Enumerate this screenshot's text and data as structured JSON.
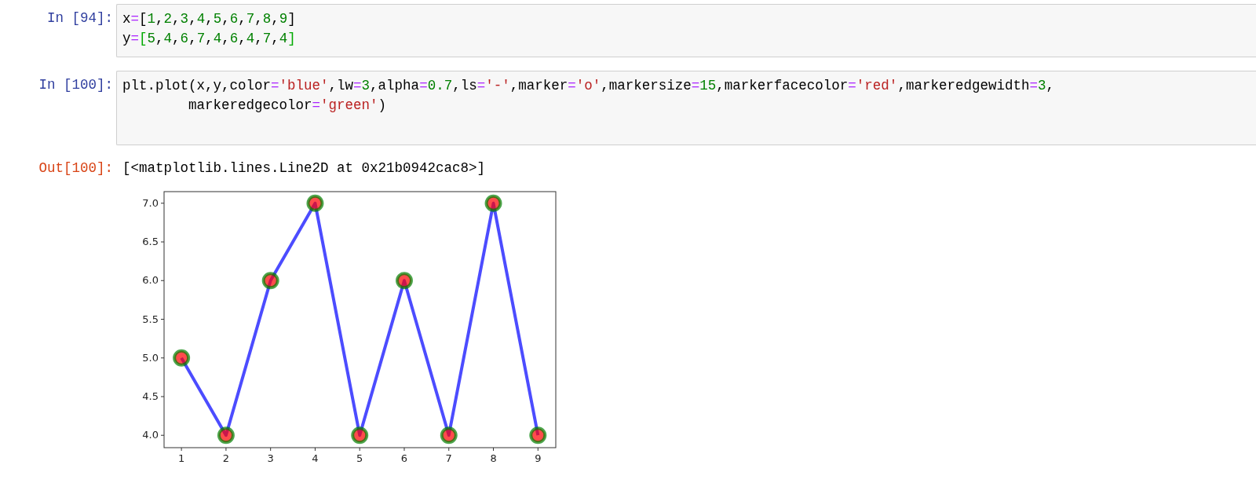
{
  "cells": [
    {
      "kind": "input",
      "prompt": "In [94]:",
      "lines": [
        [
          {
            "kind": "plain",
            "text": "x"
          },
          {
            "kind": "op",
            "text": "="
          },
          {
            "kind": "plain",
            "text": "["
          },
          {
            "kind": "num",
            "text": "1"
          },
          {
            "kind": "plain",
            "text": ","
          },
          {
            "kind": "num",
            "text": "2"
          },
          {
            "kind": "plain",
            "text": ","
          },
          {
            "kind": "num",
            "text": "3"
          },
          {
            "kind": "plain",
            "text": ","
          },
          {
            "kind": "num",
            "text": "4"
          },
          {
            "kind": "plain",
            "text": ","
          },
          {
            "kind": "num",
            "text": "5"
          },
          {
            "kind": "plain",
            "text": ","
          },
          {
            "kind": "num",
            "text": "6"
          },
          {
            "kind": "plain",
            "text": ","
          },
          {
            "kind": "num",
            "text": "7"
          },
          {
            "kind": "plain",
            "text": ","
          },
          {
            "kind": "num",
            "text": "8"
          },
          {
            "kind": "plain",
            "text": ","
          },
          {
            "kind": "num",
            "text": "9"
          },
          {
            "kind": "plain",
            "text": "]"
          }
        ],
        [
          {
            "kind": "plain",
            "text": "y"
          },
          {
            "kind": "op",
            "text": "="
          },
          {
            "kind": "match",
            "text": "["
          },
          {
            "kind": "num",
            "text": "5"
          },
          {
            "kind": "plain",
            "text": ","
          },
          {
            "kind": "num",
            "text": "4"
          },
          {
            "kind": "plain",
            "text": ","
          },
          {
            "kind": "num",
            "text": "6"
          },
          {
            "kind": "plain",
            "text": ","
          },
          {
            "kind": "num",
            "text": "7"
          },
          {
            "kind": "plain",
            "text": ","
          },
          {
            "kind": "num",
            "text": "4"
          },
          {
            "kind": "plain",
            "text": ","
          },
          {
            "kind": "num",
            "text": "6"
          },
          {
            "kind": "plain",
            "text": ","
          },
          {
            "kind": "num",
            "text": "4"
          },
          {
            "kind": "plain",
            "text": ","
          },
          {
            "kind": "num",
            "text": "7"
          },
          {
            "kind": "plain",
            "text": ","
          },
          {
            "kind": "num",
            "text": "4"
          },
          {
            "kind": "match",
            "text": "]"
          }
        ]
      ]
    },
    {
      "kind": "input",
      "prompt": "In [100]:",
      "lines": [
        [
          {
            "kind": "plain",
            "text": "plt.plot(x,y,color"
          },
          {
            "kind": "op",
            "text": "="
          },
          {
            "kind": "str",
            "text": "'blue'"
          },
          {
            "kind": "plain",
            "text": ",lw"
          },
          {
            "kind": "op",
            "text": "="
          },
          {
            "kind": "num",
            "text": "3"
          },
          {
            "kind": "plain",
            "text": ",alpha"
          },
          {
            "kind": "op",
            "text": "="
          },
          {
            "kind": "num",
            "text": "0.7"
          },
          {
            "kind": "plain",
            "text": ",ls"
          },
          {
            "kind": "op",
            "text": "="
          },
          {
            "kind": "str",
            "text": "'-'"
          },
          {
            "kind": "plain",
            "text": ",marker"
          },
          {
            "kind": "op",
            "text": "="
          },
          {
            "kind": "str",
            "text": "'o'"
          },
          {
            "kind": "plain",
            "text": ",markersize"
          },
          {
            "kind": "op",
            "text": "="
          },
          {
            "kind": "num",
            "text": "15"
          },
          {
            "kind": "plain",
            "text": ",markerfacecolor"
          },
          {
            "kind": "op",
            "text": "="
          },
          {
            "kind": "str",
            "text": "'red'"
          },
          {
            "kind": "plain",
            "text": ",markeredgewidth"
          },
          {
            "kind": "op",
            "text": "="
          },
          {
            "kind": "num",
            "text": "3"
          },
          {
            "kind": "plain",
            "text": ","
          }
        ],
        [
          {
            "kind": "plain",
            "text": "        markeredgecolor"
          },
          {
            "kind": "op",
            "text": "="
          },
          {
            "kind": "str",
            "text": "'green'"
          },
          {
            "kind": "plain",
            "text": ")"
          }
        ]
      ]
    },
    {
      "kind": "output",
      "prompt": "Out[100]:",
      "text": "[<matplotlib.lines.Line2D at 0x21b0942cac8>]"
    },
    {
      "kind": "figure",
      "chart_data": {
        "type": "line",
        "x": [
          1,
          2,
          3,
          4,
          5,
          6,
          7,
          8,
          9
        ],
        "series": [
          {
            "color": "#0000ff",
            "marker": "o",
            "values": [
              5,
              4,
              6,
              7,
              4,
              6,
              4,
              7,
              4
            ]
          }
        ],
        "xlim": [
          0.61,
          9.4
        ],
        "ylim": [
          3.84,
          7.15
        ],
        "xticks": [
          1,
          2,
          3,
          4,
          5,
          6,
          7,
          8,
          9
        ],
        "yticks": [
          {
            "value": 4,
            "label": "4.0"
          },
          {
            "value": 4.5,
            "label": "4.5"
          },
          {
            "value": 5,
            "label": "5.0"
          },
          {
            "value": 5.5,
            "label": "5.5"
          },
          {
            "value": 6,
            "label": "6.0"
          },
          {
            "value": 6.5,
            "label": "6.5"
          },
          {
            "value": 7,
            "label": "7.0"
          }
        ]
      }
    }
  ]
}
